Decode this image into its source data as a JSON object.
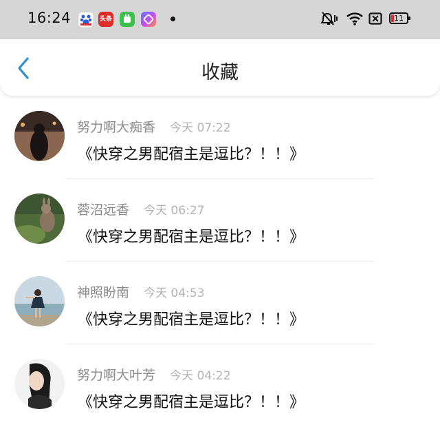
{
  "status_bar": {
    "time": "16:24",
    "apps": [
      "baidu-app-icon",
      "toutiao-app-icon",
      "wechat-like-app-icon",
      "shortcut-app-icon"
    ],
    "app_labels": {
      "toutiao": "头条"
    },
    "battery_level": "11",
    "system_icons": [
      "mute-icon",
      "wifi-icon",
      "sim-icon"
    ]
  },
  "header": {
    "title": "收藏",
    "back_icon": "chevron-left-icon",
    "accent_color": "#2b8fd6"
  },
  "favorites": [
    {
      "user": "努力啊大痴香",
      "time": "今天 07:22",
      "text": "《快穿之男配宿主是逗比？！！》"
    },
    {
      "user": "蓉沼远香",
      "time": "今天 06:27",
      "text": "《快穿之男配宿主是逗比？！！》"
    },
    {
      "user": "神照盼南",
      "time": "今天 04:53",
      "text": "《快穿之男配宿主是逗比？！！》"
    },
    {
      "user": "努力啊大叶芳",
      "time": "今天 04:22",
      "text": "《快穿之男配宿主是逗比？！！》"
    }
  ]
}
